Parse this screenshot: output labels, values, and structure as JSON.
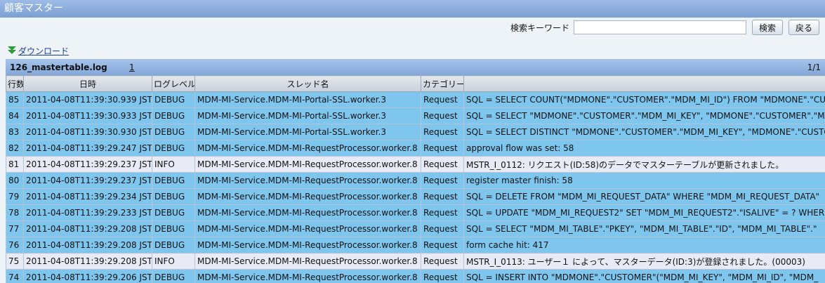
{
  "window": {
    "title": "顧客マスター"
  },
  "search": {
    "label": "検索キーワード",
    "value": "",
    "placeholder": "",
    "search_button": "検索",
    "back_button": "戻る"
  },
  "download": {
    "label": "ダウンロード",
    "icon": "download-arrow-icon",
    "icon_color": "#2f9a3a"
  },
  "file": {
    "name": "126_mastertable.log",
    "page_link": "1",
    "page_info": "1/1"
  },
  "table": {
    "columns": [
      "行数",
      "日時",
      "ログレベル",
      "スレッド名",
      "カテゴリー",
      ""
    ],
    "rows": [
      {
        "no": "85",
        "datetime": "2011-04-08T11:39:30.939 JST",
        "level": "DEBUG",
        "thread": "MDM-MI-Service.MDM-MI-Portal-SSL.worker.3",
        "category": "Request",
        "message": "SQL = SELECT COUNT(\"MDMONE\".\"CUSTOMER\".\"MDM_MI_ID\") FROM \"MDMONE\".\"CUSTOMER\""
      },
      {
        "no": "84",
        "datetime": "2011-04-08T11:39:30.933 JST",
        "level": "DEBUG",
        "thread": "MDM-MI-Service.MDM-MI-Portal-SSL.worker.3",
        "category": "Request",
        "message": "SQL = SELECT \"MDMONE\".\"CUSTOMER\".\"MDM_MI_KEY\", \"MDMONE\".\"CUSTOMER\".\"MDM_MI_ID\""
      },
      {
        "no": "83",
        "datetime": "2011-04-08T11:39:30.930 JST",
        "level": "DEBUG",
        "thread": "MDM-MI-Service.MDM-MI-Portal-SSL.worker.3",
        "category": "Request",
        "message": "SQL = SELECT DISTINCT \"MDMONE\".\"CUSTOMER\".\"MDM_MI_KEY\", \"MDMONE\".\"CUSTOMER\""
      },
      {
        "no": "82",
        "datetime": "2011-04-08T11:39:29.247 JST",
        "level": "DEBUG",
        "thread": "MDM-MI-Service.MDM-MI-RequestProcessor.worker.8",
        "category": "Request",
        "message": "approval flow was set: 58"
      },
      {
        "no": "81",
        "datetime": "2011-04-08T11:39:29.237 JST",
        "level": "INFO",
        "thread": "MDM-MI-Service.MDM-MI-RequestProcessor.worker.8",
        "category": "Request",
        "message": "MSTR_I_0112: リクエスト(ID:58)のデータでマスターテーブルが更新されました。"
      },
      {
        "no": "80",
        "datetime": "2011-04-08T11:39:29.237 JST",
        "level": "DEBUG",
        "thread": "MDM-MI-Service.MDM-MI-RequestProcessor.worker.8",
        "category": "Request",
        "message": "register master finish: 58"
      },
      {
        "no": "79",
        "datetime": "2011-04-08T11:39:29.234 JST",
        "level": "DEBUG",
        "thread": "MDM-MI-Service.MDM-MI-RequestProcessor.worker.8",
        "category": "Request",
        "message": "SQL = DELETE FROM \"MDM_MI_REQUEST_DATA\" WHERE \"MDM_MI_REQUEST_DATA\""
      },
      {
        "no": "78",
        "datetime": "2011-04-08T11:39:29.233 JST",
        "level": "DEBUG",
        "thread": "MDM-MI-Service.MDM-MI-RequestProcessor.worker.8",
        "category": "Request",
        "message": "SQL = UPDATE \"MDM_MI_REQUEST2\" SET \"MDM_MI_REQUEST2\".\"ISALIVE\" = ? WHERE"
      },
      {
        "no": "77",
        "datetime": "2011-04-08T11:39:29.208 JST",
        "level": "DEBUG",
        "thread": "MDM-MI-Service.MDM-MI-RequestProcessor.worker.8",
        "category": "Request",
        "message": "SQL = SELECT \"MDM_MI_TABLE\".\"PKEY\", \"MDM_MI_TABLE\".\"ID\", \"MDM_MI_TABLE\".\""
      },
      {
        "no": "76",
        "datetime": "2011-04-08T11:39:29.208 JST",
        "level": "DEBUG",
        "thread": "MDM-MI-Service.MDM-MI-RequestProcessor.worker.8",
        "category": "Request",
        "message": "form cache hit: 417"
      },
      {
        "no": "75",
        "datetime": "2011-04-08T11:39:29.208 JST",
        "level": "INFO",
        "thread": "MDM-MI-Service.MDM-MI-RequestProcessor.worker.8",
        "category": "Request",
        "message": "MSTR_I_0113: ユーザー１ によって、マスターデータ(ID:3)が登録されました。(00003)"
      },
      {
        "no": "74",
        "datetime": "2011-04-08T11:39:29.206 JST",
        "level": "DEBUG",
        "thread": "MDM-MI-Service.MDM-MI-RequestProcessor.worker.8",
        "category": "Request",
        "message": "SQL = INSERT INTO \"MDMONE\".\"CUSTOMER\"(\"MDM_MI_KEY\", \"MDM_MI_ID\", \"MDM_"
      }
    ]
  },
  "colors": {
    "title_bar": "#86a8d9",
    "debug_row": "#7ec6ee",
    "info_row": "#e8eaf5"
  }
}
